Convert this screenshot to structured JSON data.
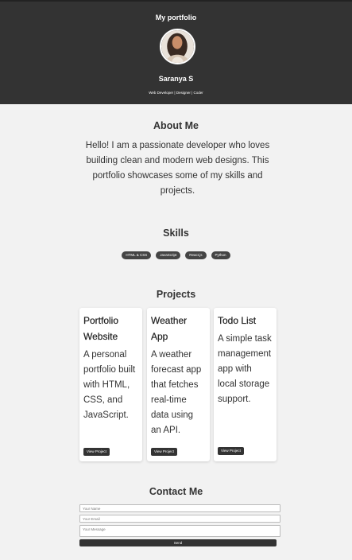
{
  "header": {
    "site_title": "My portfolio",
    "name": "Saranya S",
    "tagline": "Web Developer | Designer | Coder",
    "bg_color": "#333333"
  },
  "about": {
    "title": "About Me",
    "text": "Hello! I am a passionate developer who loves building clean and modern web designs. This portfolio showcases some of my skills and projects."
  },
  "skills": {
    "title": "Skills",
    "items": [
      "HTML & CSS",
      "JavaScript",
      "React.js",
      "Python"
    ]
  },
  "projects": {
    "title": "Projects",
    "items": [
      {
        "title": "Portfolio Website",
        "description": "A personal portfolio built with HTML, CSS, and JavaScript.",
        "button": "View Project"
      },
      {
        "title": "Weather App",
        "description": "A weather forecast app that fetches real-time data using an API.",
        "button": "View Project"
      },
      {
        "title": "Todo List",
        "description": "A simple task management app with local storage support.",
        "button": "View Project"
      }
    ]
  },
  "contact": {
    "title": "Contact Me",
    "name_placeholder": "Your Name",
    "email_placeholder": "Your Email",
    "message_placeholder": "Your Message",
    "send_label": "Send"
  }
}
